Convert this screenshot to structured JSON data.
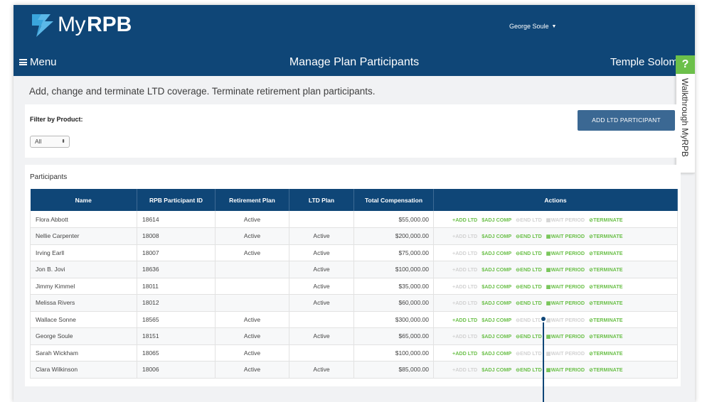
{
  "header": {
    "logo_my": "My",
    "logo_rpb": "RPB",
    "user_name": "George Soule",
    "menu_label": "Menu",
    "page_title": "Manage Plan Participants",
    "org_name": "Temple Solom",
    "help_label": "?",
    "walkthrough_label": "Walkthrough MyRPB"
  },
  "intro_text": "Add, change and terminate LTD coverage. Terminate retirement plan participants.",
  "filter": {
    "label": "Filter by Product:",
    "selected": "All",
    "add_button": "ADD LTD PARTICIPANT"
  },
  "participants": {
    "title": "Participants",
    "columns": [
      "Name",
      "RPB Participant ID",
      "Retirement Plan",
      "LTD Plan",
      "Total Compensation",
      "Actions"
    ],
    "action_labels": [
      "+ADD LTD",
      "$ADJ COMP",
      "⊖END LTD",
      "▦WAIT PERIOD",
      "⊘TERMINATE"
    ],
    "rows": [
      {
        "name": "Flora Abbott",
        "id": "18614",
        "ret": "Active",
        "ltd": "",
        "comp": "$55,000.00",
        "enabled": [
          true,
          true,
          false,
          false,
          true
        ]
      },
      {
        "name": "Nellie Carpenter",
        "id": "18008",
        "ret": "Active",
        "ltd": "Active",
        "comp": "$200,000.00",
        "enabled": [
          false,
          true,
          true,
          true,
          true
        ]
      },
      {
        "name": "Irving Earll",
        "id": "18007",
        "ret": "Active",
        "ltd": "Active",
        "comp": "$75,000.00",
        "enabled": [
          false,
          true,
          true,
          true,
          true
        ]
      },
      {
        "name": "Jon B. Jovi",
        "id": "18636",
        "ret": "",
        "ltd": "Active",
        "comp": "$100,000.00",
        "enabled": [
          false,
          true,
          true,
          true,
          true
        ]
      },
      {
        "name": "Jimmy Kimmel",
        "id": "18011",
        "ret": "",
        "ltd": "Active",
        "comp": "$35,000.00",
        "enabled": [
          false,
          true,
          true,
          true,
          true
        ]
      },
      {
        "name": "Melissa Rivers",
        "id": "18012",
        "ret": "",
        "ltd": "Active",
        "comp": "$60,000.00",
        "enabled": [
          false,
          true,
          true,
          true,
          true
        ]
      },
      {
        "name": "Wallace Sonne",
        "id": "18565",
        "ret": "Active",
        "ltd": "",
        "comp": "$300,000.00",
        "enabled": [
          true,
          true,
          false,
          false,
          true
        ]
      },
      {
        "name": "George Soule",
        "id": "18151",
        "ret": "Active",
        "ltd": "Active",
        "comp": "$65,000.00",
        "enabled": [
          false,
          true,
          true,
          true,
          true
        ]
      },
      {
        "name": "Sarah Wickham",
        "id": "18065",
        "ret": "Active",
        "ltd": "",
        "comp": "$100,000.00",
        "enabled": [
          true,
          true,
          false,
          false,
          true
        ]
      },
      {
        "name": "Clara Wilkinson",
        "id": "18006",
        "ret": "Active",
        "ltd": "Active",
        "comp": "$85,000.00",
        "enabled": [
          false,
          true,
          true,
          true,
          true
        ]
      }
    ]
  },
  "colors": {
    "brand_navy": "#0f4677",
    "button_blue": "#3b6893",
    "action_green": "#6cc04a",
    "action_disabled": "#d2d2d2"
  }
}
